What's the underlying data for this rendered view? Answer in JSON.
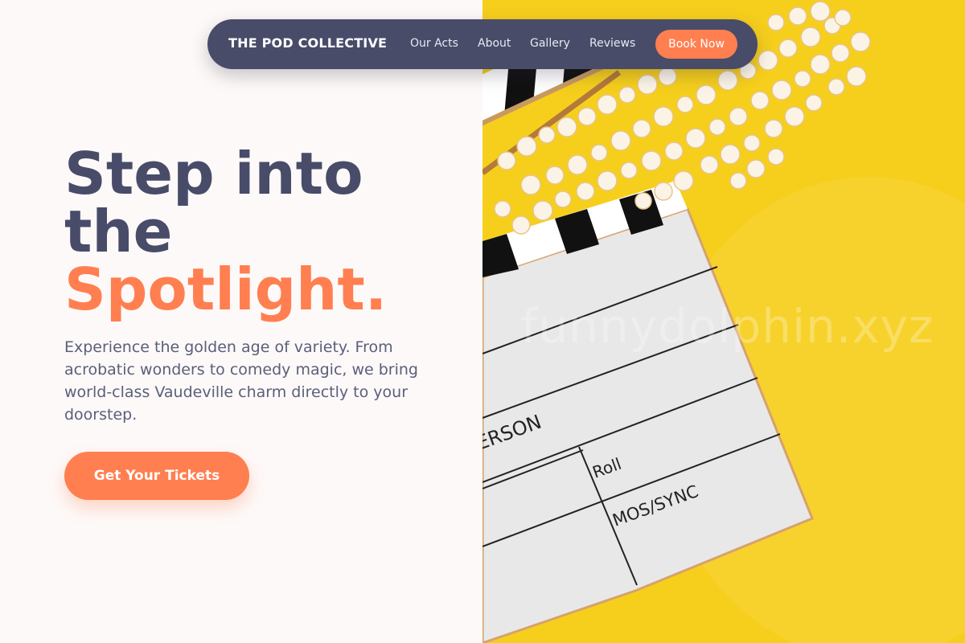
{
  "nav": {
    "brand": "THE POD COLLECTIVE",
    "links": [
      "Our Acts",
      "About",
      "Gallery",
      "Reviews"
    ],
    "cta": "Book Now"
  },
  "hero": {
    "headline_line1": "Step into",
    "headline_line2": "the",
    "headline_accent": "Spotlight.",
    "subtitle": "Experience the golden age of variety. From acrobatic wonders to comedy magic, we bring world-class Vaudeville charm directly to your doorstep.",
    "cta": "Get Your Tickets"
  },
  "image": {
    "slate_labels": [
      "ERSON",
      "Roll",
      "MOS/SYNC"
    ],
    "watermark": "funnydolphin.xyz"
  },
  "colors": {
    "navy": "#484c69",
    "coral": "#ff7f50",
    "background": "#fdf9f8",
    "yellow": "#f6cf1c"
  }
}
